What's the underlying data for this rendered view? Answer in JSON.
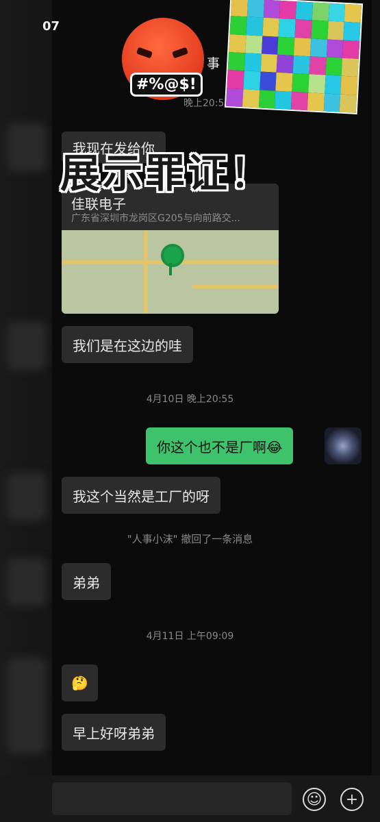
{
  "status_bar": {
    "time": "07"
  },
  "header": {
    "title": "事",
    "more_label": "·",
    "time": "晚上20:51"
  },
  "overlay": {
    "cursing_text": "#%@$!",
    "caption": "展示罪证！"
  },
  "messages": {
    "m1": "我现在发给你",
    "location": {
      "name": "佳联电子",
      "address": "广东省深圳市龙岗区G205与向前路交..."
    },
    "m2": "我们是在这边的哇",
    "time1": "4月10日 晚上20:55",
    "me1": "你这个也不是厂啊😂",
    "m3": "我这个当然是工厂的呀",
    "recall_notice": "\"人事小沫\" 撤回了一条消息",
    "m4": "弟弟",
    "time2": "4月11日 上午09:09",
    "m5_emoji": "🤔",
    "m6": "早上好呀弟弟"
  },
  "input_bar": {
    "emoji_icon": "☺",
    "plus_icon": "+"
  },
  "colors": {
    "accent": "#3ec26b",
    "bubble": "#2c2c2c",
    "background": "#0b0b0b"
  }
}
